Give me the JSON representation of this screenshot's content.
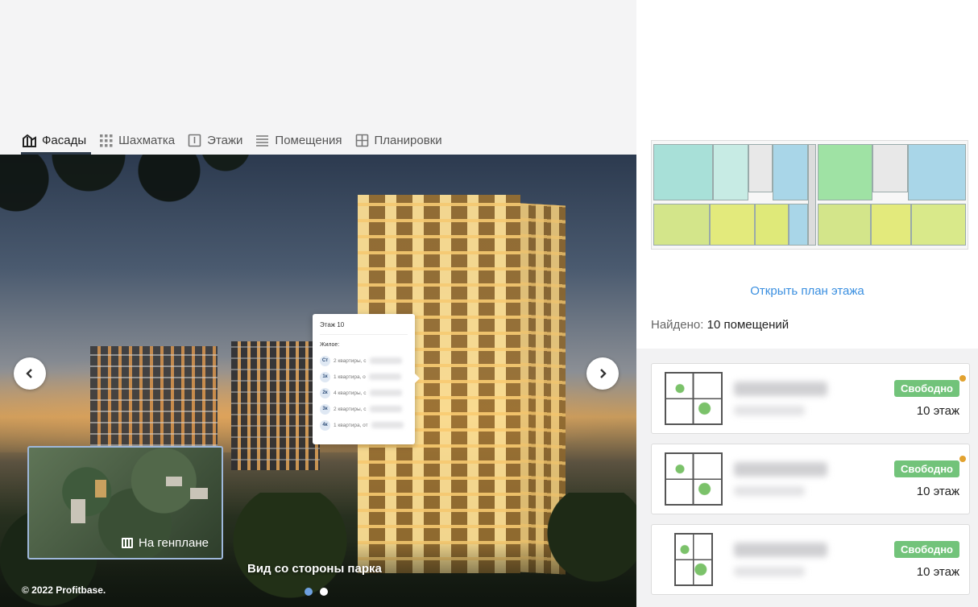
{
  "tabs": [
    {
      "label": "Фасады",
      "icon": "facade-icon",
      "active": true
    },
    {
      "label": "Шахматка",
      "icon": "grid-icon",
      "active": false
    },
    {
      "label": "Этажи",
      "icon": "floor-icon",
      "active": false
    },
    {
      "label": "Помещения",
      "icon": "list-icon",
      "active": false
    },
    {
      "label": "Планировки",
      "icon": "layout-icon",
      "active": false
    }
  ],
  "popup": {
    "title": "Этаж 10",
    "subtitle": "Жилое:",
    "rows": [
      {
        "badge": "Ст",
        "text": "2 квартиры, с"
      },
      {
        "badge": "1к",
        "text": "1 квартира, о"
      },
      {
        "badge": "2к",
        "text": "4 квартиры, с"
      },
      {
        "badge": "3к",
        "text": "2 квартиры, с"
      },
      {
        "badge": "4к",
        "text": "1 квартира, от"
      }
    ]
  },
  "genplan": {
    "label": "На генплане",
    "icon": "map-icon"
  },
  "caption": "Вид со стороны парка",
  "copyright": "© 2022 Profitbase.",
  "slider": {
    "total": 2,
    "active": 1
  },
  "sidebar": {
    "open_plan": "Открыть план этажа",
    "found_label": "Найдено:",
    "found_value": "10 помещений",
    "cards": [
      {
        "status": "Свободно",
        "floor": "10 этаж"
      },
      {
        "status": "Свободно",
        "floor": "10 этаж"
      },
      {
        "status": "Свободно",
        "floor": "10 этаж"
      }
    ]
  },
  "colors": {
    "accent": "#3a8fe0",
    "status_free": "#72c37a",
    "badge_dot": "#e2a230"
  }
}
